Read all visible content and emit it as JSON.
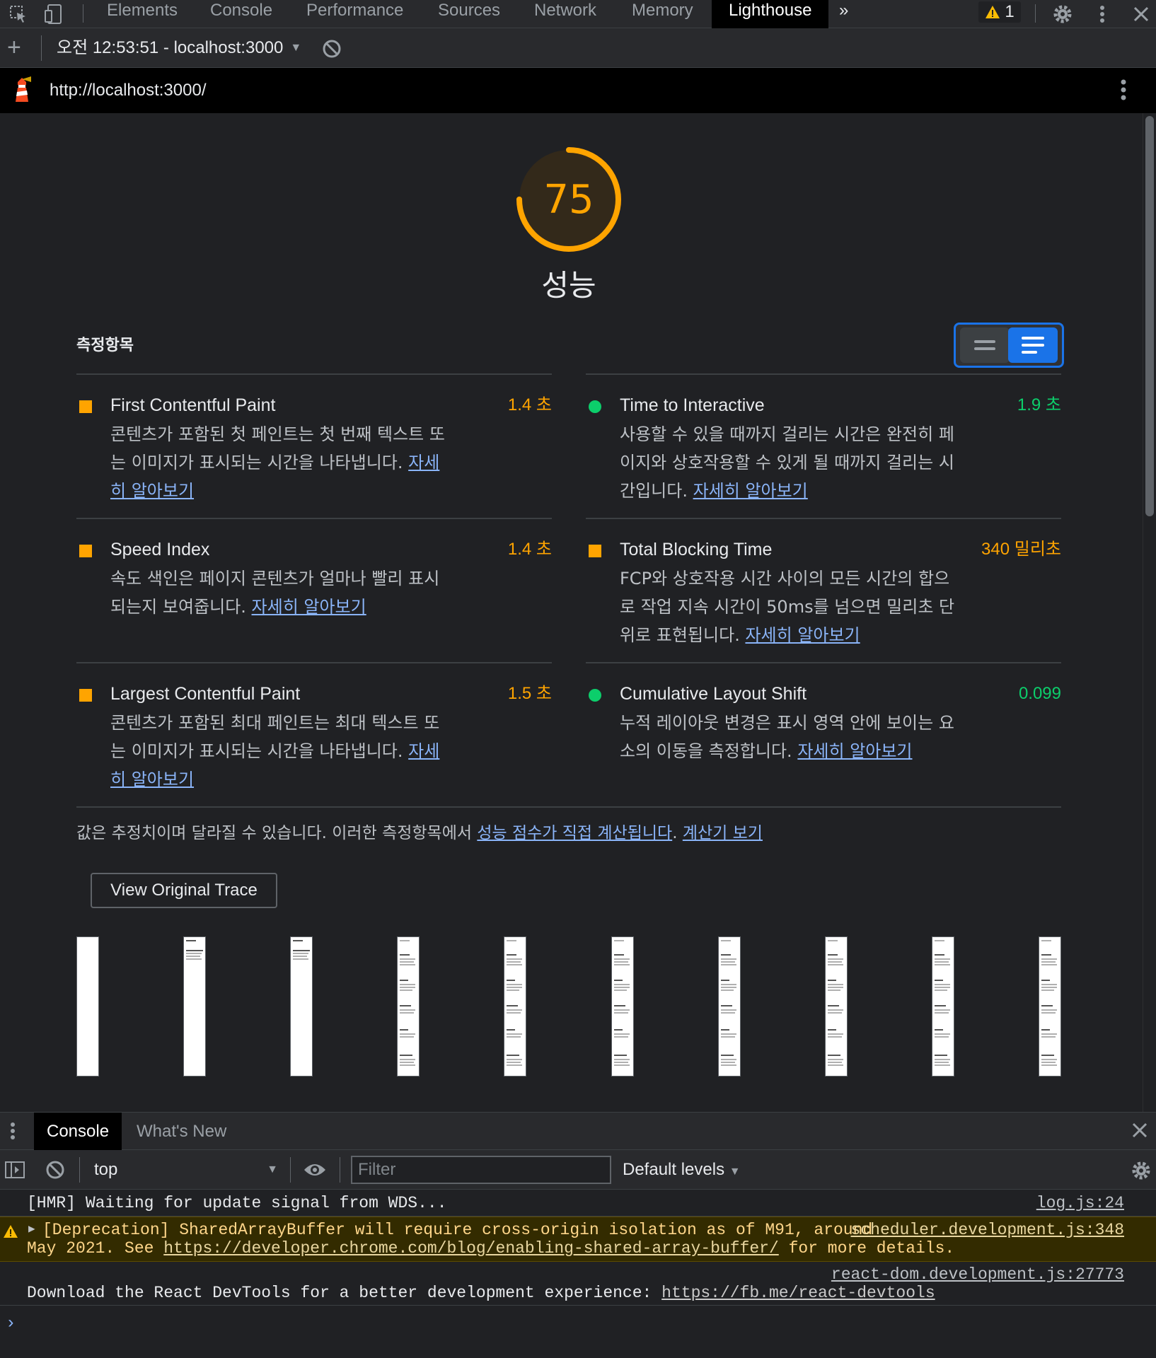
{
  "devtools": {
    "tabs": [
      "Elements",
      "Console",
      "Performance",
      "Sources",
      "Network",
      "Memory",
      "Lighthouse"
    ],
    "active_tab": "Lighthouse",
    "more_tabs_glyph": "»",
    "warning_count": "1"
  },
  "report_bar": {
    "add_glyph": "+",
    "selected_report": "오전 12:53:51 - localhost:3000"
  },
  "url_bar": {
    "url": "http://localhost:3000/"
  },
  "gauge": {
    "score": "75",
    "score_value": 75,
    "title": "성능",
    "color": "#ffa400"
  },
  "metrics_section": {
    "header": "측정항목",
    "learn_more": "자세히 알아보기",
    "items": [
      {
        "title": "First Contentful Paint",
        "value": "1.4 초",
        "status": "average",
        "desc": "콘텐츠가 포함된 첫 페인트는 첫 번째 텍스트 또는 이미지가 표시되는 시간을 나타냅니다. "
      },
      {
        "title": "Time to Interactive",
        "value": "1.9 초",
        "status": "pass",
        "desc": "사용할 수 있을 때까지 걸리는 시간은 완전히 페이지와 상호작용할 수 있게 될 때까지 걸리는 시간입니다. "
      },
      {
        "title": "Speed Index",
        "value": "1.4 초",
        "status": "average",
        "desc": "속도 색인은 페이지 콘텐츠가 얼마나 빨리 표시되는지 보여줍니다. "
      },
      {
        "title": "Total Blocking Time",
        "value": "340 밀리초",
        "status": "average",
        "desc": "FCP와 상호작용 시간 사이의 모든 시간의 합으로 작업 지속 시간이 50ms를 넘으면 밀리초 단위로 표현됩니다. "
      },
      {
        "title": "Largest Contentful Paint",
        "value": "1.5 초",
        "status": "average",
        "desc": "콘텐츠가 포함된 최대 페인트는 최대 텍스트 또는 이미지가 표시되는 시간을 나타냅니다. "
      },
      {
        "title": "Cumulative Layout Shift",
        "value": "0.099",
        "status": "pass",
        "desc": "누적 레이아웃 변경은 표시 영역 안에 보이는 요소의 이동을 측정합니다. "
      }
    ],
    "colors": {
      "average": "#ffa400",
      "pass": "#0cce6b"
    }
  },
  "footnote": {
    "text": "값은 추정치이며 달라질 수 있습니다. 이러한 측정항목에서 ",
    "link1": "성능 점수가 직접 계산됩니다",
    "sep": ". ",
    "link2": "계산기 보기"
  },
  "trace_button": "View Original Trace",
  "filmstrip": {
    "frames": [
      {
        "content": "blank"
      },
      {
        "content": "header"
      },
      {
        "content": "header"
      },
      {
        "content": "full"
      },
      {
        "content": "full"
      },
      {
        "content": "full"
      },
      {
        "content": "full"
      },
      {
        "content": "full"
      },
      {
        "content": "full"
      },
      {
        "content": "full"
      }
    ]
  },
  "drawer": {
    "tabs": [
      "Console",
      "What's New"
    ],
    "active_tab": "Console"
  },
  "console_toolbar": {
    "context": "top",
    "filter_placeholder": "Filter",
    "levels": "Default levels"
  },
  "console_messages": [
    {
      "level": "info",
      "text": "[HMR] Waiting for update signal from WDS...",
      "source": "log.js:24"
    },
    {
      "level": "warning",
      "line1": "[Deprecation] SharedArrayBuffer will require cross-origin isolation as of M91, around",
      "line2_pre": "May 2021. See ",
      "line2_link": "https://developer.chrome.com/blog/enabling-shared-array-buffer/",
      "line2_post": " for more details.",
      "source": "scheduler.development.js:348"
    },
    {
      "level": "info",
      "text_pre": "Download the React DevTools for a better development experience: ",
      "text_link": "https://fb.me/react-devtools",
      "source": "react-dom.development.js:27773"
    }
  ],
  "prompt_glyph": "›"
}
